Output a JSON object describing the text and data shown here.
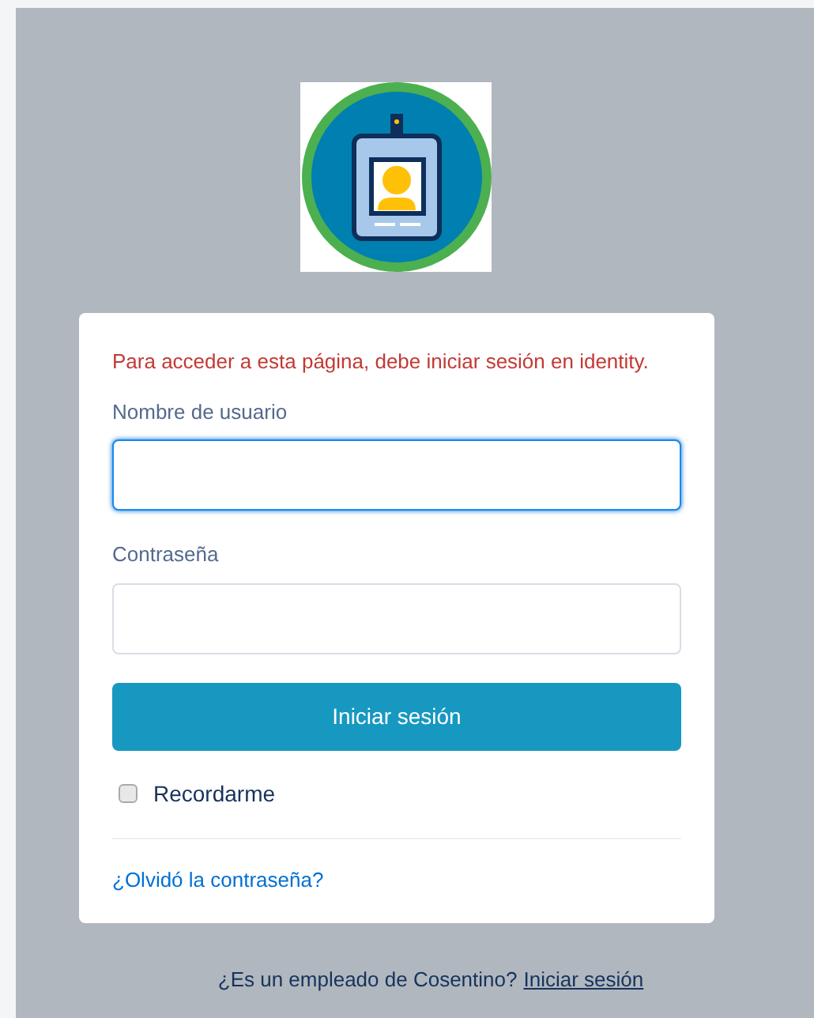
{
  "error_message": "Para acceder a esta página, debe iniciar sesión en identity.",
  "fields": [
    {
      "label": "Nombre de usuario",
      "focused": true
    },
    {
      "label": "Contraseña",
      "focused": false
    }
  ],
  "login_button": "Iniciar sesión",
  "remember": {
    "label": "Recordarme",
    "checked": false
  },
  "forgot_link": "¿Olvidó la contraseña?",
  "footer": {
    "text": "¿Es un empleado de Cosentino?",
    "link": "Iniciar sesión"
  }
}
